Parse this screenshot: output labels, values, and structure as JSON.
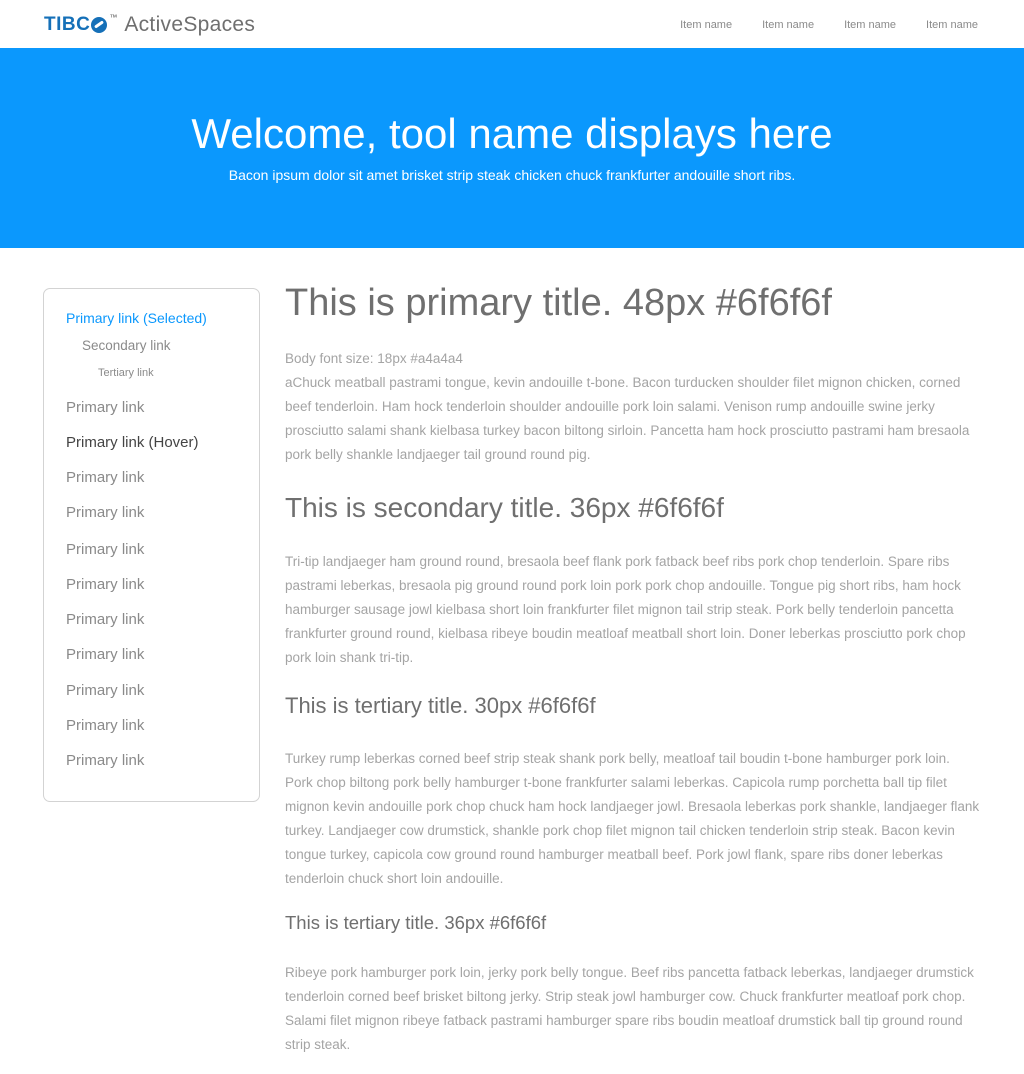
{
  "header": {
    "logo": {
      "brand": "TIBC",
      "tm": "™",
      "product": "ActiveSpaces"
    },
    "nav": [
      "Item name",
      "Item name",
      "Item name",
      "Item name"
    ]
  },
  "hero": {
    "title": "Welcome, tool name displays here",
    "subtitle": "Bacon ipsum dolor sit amet brisket strip steak chicken chuck frankfurter andouille short ribs.",
    "background": "#0b98fd"
  },
  "sidebar": {
    "selected": "Primary link (Selected)",
    "secondary": "Secondary link",
    "tertiary": "Tertiary link",
    "items": [
      "Primary link",
      "Primary link (Hover)",
      "Primary link",
      "Primary link",
      "Primary link",
      "Primary link",
      "Primary link",
      "Primary link",
      "Primary link",
      "Primary link",
      "Primary link"
    ],
    "accent_color": "#0b98fd"
  },
  "content": {
    "primary_title": "This is primary title. 48px #6f6f6f",
    "body_note": "Body font size: 18px #a4a4a4",
    "para1": "aChuck meatball pastrami tongue, kevin andouille t-bone. Bacon turducken shoulder filet mignon chicken, corned beef tenderloin. Ham hock tenderloin shoulder andouille pork loin salami. Venison rump andouille swine jerky prosciutto salami shank kielbasa turkey bacon biltong sirloin. Pancetta ham hock prosciutto pastrami ham bresaola pork belly shankle landjaeger tail ground round pig.",
    "secondary_title": "This is secondary title. 36px #6f6f6f",
    "para2": "Tri-tip landjaeger ham ground round, bresaola beef flank pork fatback beef ribs pork chop tenderloin. Spare ribs pastrami leberkas, bresaola pig ground round pork loin pork pork chop andouille. Tongue pig short ribs, ham hock hamburger sausage jowl kielbasa short loin frankfurter filet mignon tail strip steak. Pork belly tenderloin pancetta frankfurter ground round, kielbasa ribeye boudin meatloaf meatball short loin. Doner leberkas prosciutto pork chop pork loin shank tri-tip.",
    "tertiary_title_30": "This is tertiary title. 30px #6f6f6f",
    "para3": "Turkey rump leberkas corned beef strip steak shank pork belly, meatloaf tail boudin t-bone hamburger pork loin. Pork chop biltong pork belly hamburger t-bone frankfurter salami leberkas. Capicola rump porchetta ball tip filet mignon kevin andouille pork chop chuck ham hock landjaeger jowl. Bresaola leberkas pork shankle, landjaeger flank turkey. Landjaeger cow drumstick, shankle pork chop filet mignon tail chicken tenderloin strip steak. Bacon kevin tongue turkey, capicola cow ground round hamburger meatball beef. Pork jowl flank, spare ribs doner leberkas tenderloin chuck short loin andouille.",
    "tertiary_title_36": "This is tertiary title. 36px #6f6f6f",
    "para4": "Ribeye pork hamburger pork loin, jerky pork belly tongue. Beef ribs pancetta fatback leberkas, landjaeger drumstick tenderloin corned beef brisket biltong jerky. Strip steak jowl hamburger cow. Chuck frankfurter meatloaf pork chop. Salami filet mignon ribeye fatback pastrami hamburger spare ribs boudin meatloaf drumstick ball tip ground round strip steak."
  }
}
